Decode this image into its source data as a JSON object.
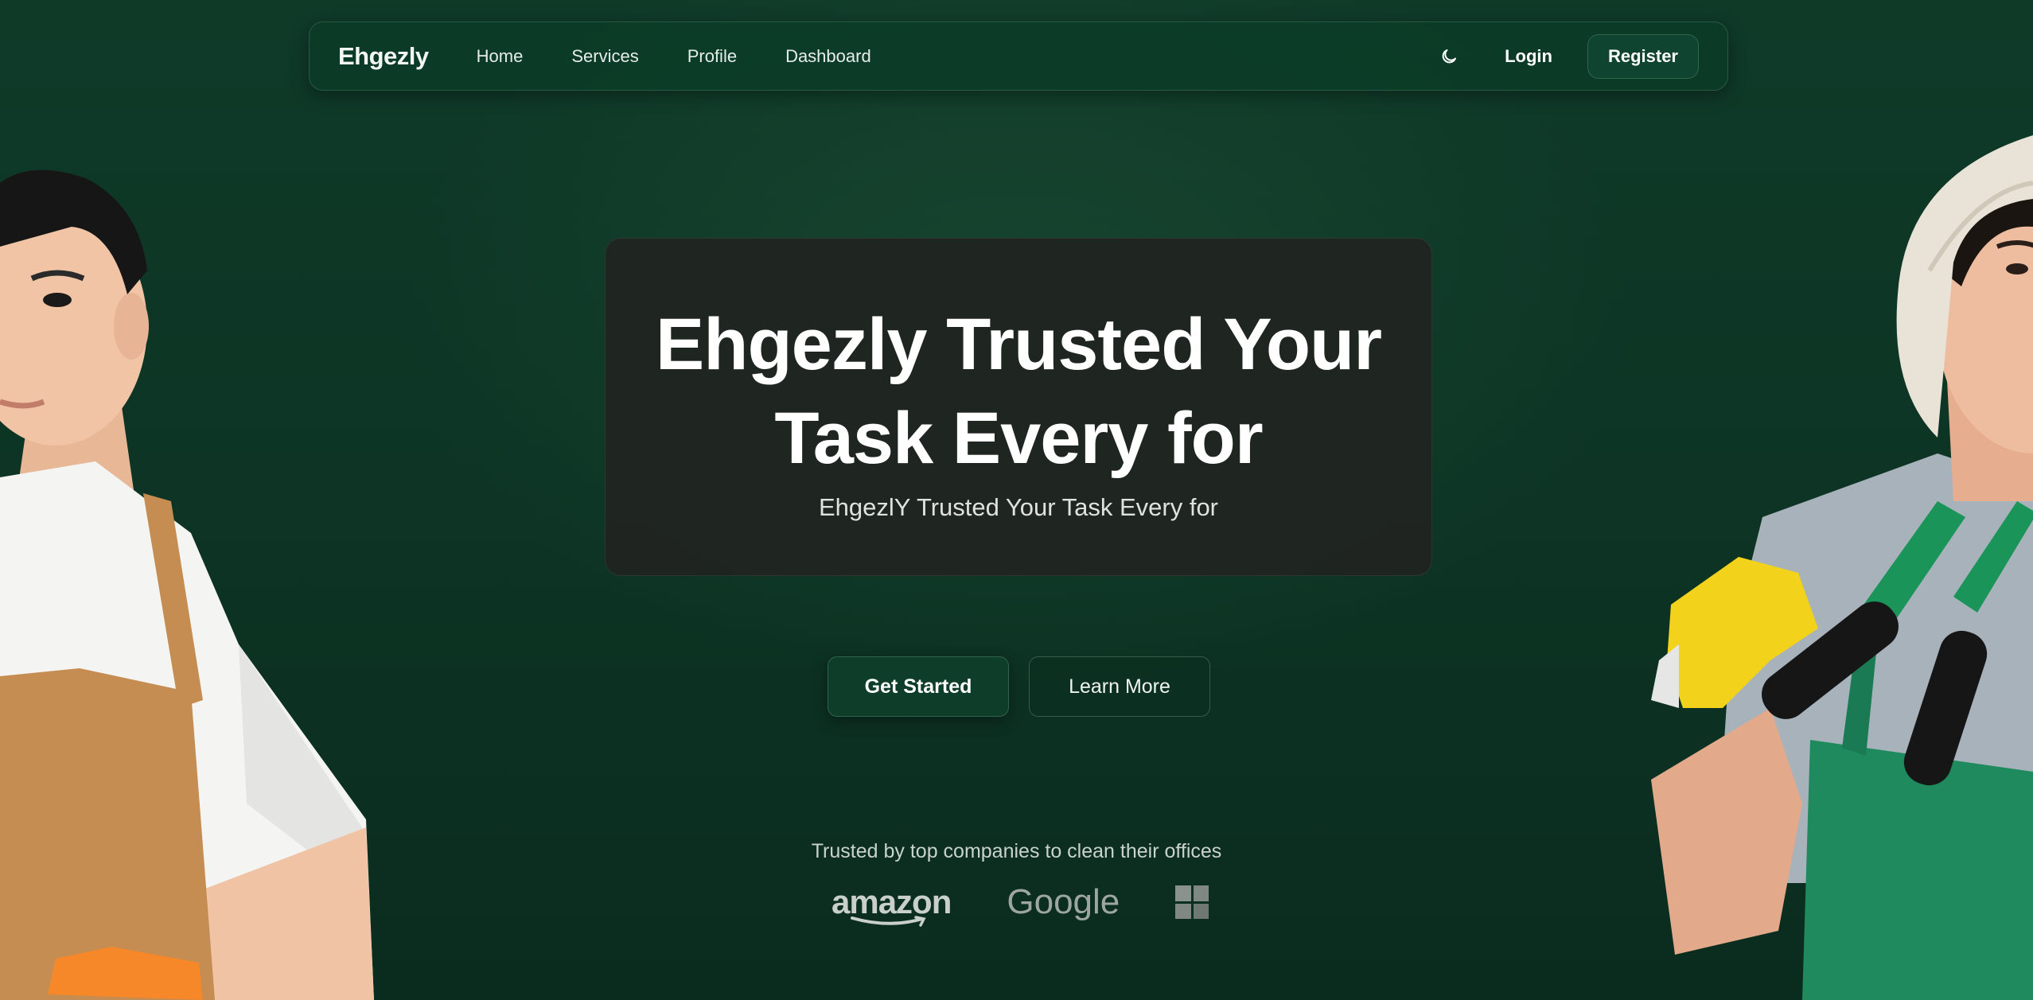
{
  "navbar": {
    "brand": "Ehgezly",
    "links": [
      {
        "label": "Home"
      },
      {
        "label": "Services"
      },
      {
        "label": "Profile"
      },
      {
        "label": "Dashboard"
      }
    ],
    "theme_icon": "moon-icon",
    "login_label": "Login",
    "register_label": "Register"
  },
  "hero": {
    "title_line1": "Ehgezly Trusted Your",
    "title_line2": "Task Every for",
    "subtitle": "EhgezlY Trusted Your Task Every for"
  },
  "cta": {
    "primary_label": "Get Started",
    "secondary_label": "Learn More"
  },
  "trusted": {
    "text": "Trusted by top companies to clean their offices",
    "logos": [
      "amazon",
      "Google",
      "windows-logo"
    ]
  },
  "colors": {
    "background": "#0d3424",
    "navbar": "#0b3c27",
    "card": "#202420",
    "accent": "#0e3d2a"
  }
}
